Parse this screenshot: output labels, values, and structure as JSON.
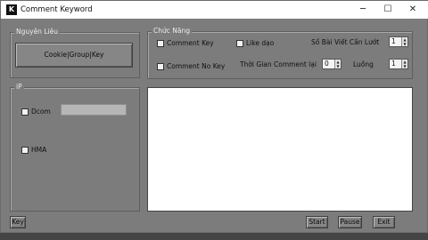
{
  "window": {
    "title": "Comment Keyword",
    "icon_letter": "K",
    "controls": {
      "minimize": "─",
      "maximize": "☐",
      "close": "✕"
    }
  },
  "nguyen_lieu": {
    "label": "Nguyên Liêu",
    "cookie_button": "Cookie|Group|Key"
  },
  "ip": {
    "label": "iP",
    "dcom_label": "Dcom",
    "dcom_value": "",
    "hma_label": "HMA"
  },
  "chuc_nang": {
    "label": "Chức Năng",
    "comment_key": "Comment Key",
    "like_dao": "Like dạo",
    "so_bai_viet_label": "Số Bài Viết Cần Lướt",
    "so_bai_viet_value": "1",
    "comment_no_key": "Comment No Key",
    "thoi_gian_label": "Thời Gian Comment lại",
    "thoi_gian_value": "0",
    "luong_label": "Luồng",
    "luong_value": "1"
  },
  "output": {
    "text": ""
  },
  "footer": {
    "key_button": "Key",
    "start_button": "Start",
    "pause_button": "Pause",
    "exit_button": "Exit"
  }
}
